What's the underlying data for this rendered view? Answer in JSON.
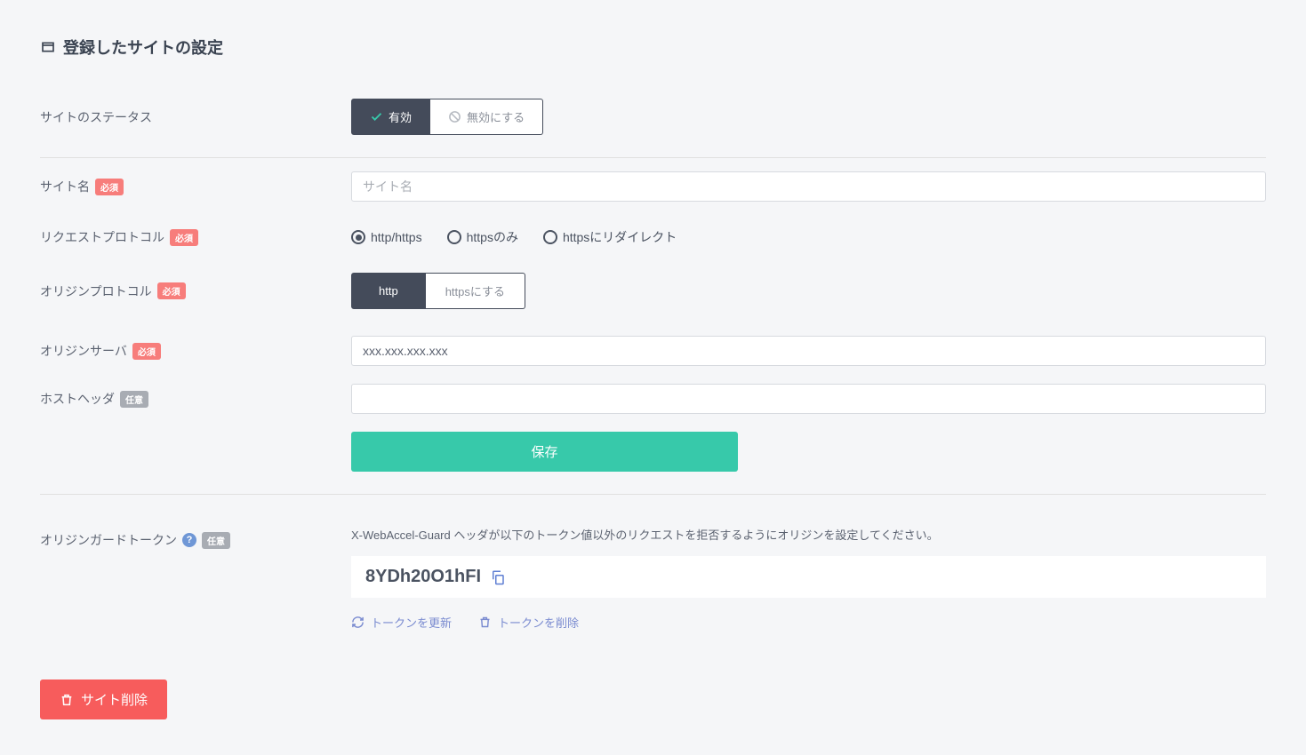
{
  "page_title": "登録したサイトの設定",
  "labels": {
    "status": "サイトのステータス",
    "site_name": "サイト名",
    "request_protocol": "リクエストプロトコル",
    "origin_protocol": "オリジンプロトコル",
    "origin_server": "オリジンサーバ",
    "host_header": "ホストヘッダ",
    "origin_guard_token": "オリジンガードトークン"
  },
  "badges": {
    "required": "必須",
    "optional": "任意"
  },
  "status_toggle": {
    "active": "有効",
    "inactive": "無効にする"
  },
  "site_name_placeholder": "サイト名",
  "request_protocol_options": {
    "both": "http/https",
    "https_only": "httpsのみ",
    "redirect_https": "httpsにリダイレクト"
  },
  "origin_protocol_toggle": {
    "http": "http",
    "https": "httpsにする"
  },
  "origin_server_value": "xxx.xxx.xxx.xxx",
  "host_header_value": "",
  "save_button": "保存",
  "token": {
    "hint": "X-WebAccel-Guard ヘッダが以下のトークン値以外のリクエストを拒否するようにオリジンを設定してください。",
    "value": "8YDh20O1hFI",
    "refresh": "トークンを更新",
    "delete": "トークンを削除"
  },
  "delete_site": "サイト削除"
}
